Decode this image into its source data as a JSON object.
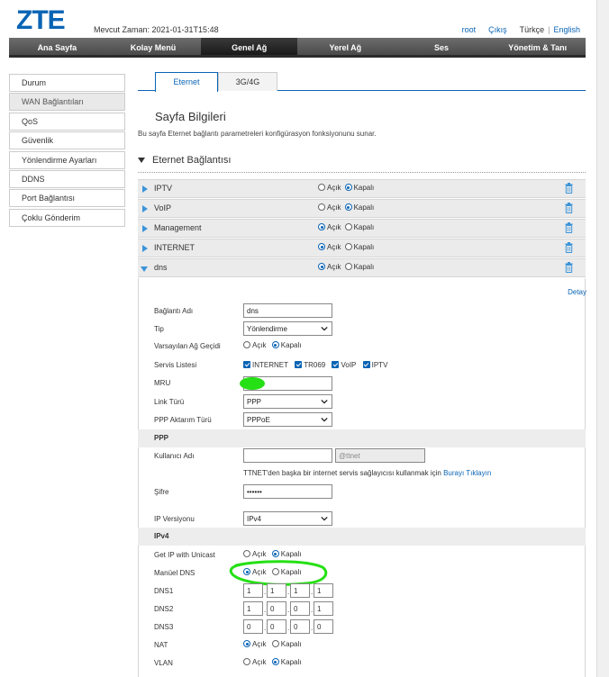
{
  "header": {
    "logo": "ZTE",
    "time_label": "Mevcut Zaman: 2021-01-31T15:48",
    "user": "root",
    "logout": "Çıkış",
    "lang_tr": "Türkçe",
    "lang_sep": "|",
    "lang_en": "English"
  },
  "nav": [
    "Ana Sayfa",
    "Kolay Menü",
    "Genel Ağ",
    "Yerel Ağ",
    "Ses",
    "Yönetim & Tanı"
  ],
  "sidebar": [
    "Durum",
    "WAN Bağlantıları",
    "QoS",
    "Güvenlik",
    "Yönlendirme Ayarları",
    "DDNS",
    "Port Bağlantısı",
    "Çoklu Gönderim"
  ],
  "tabs": [
    "Eternet",
    "3G/4G"
  ],
  "page": {
    "title": "Sayfa Bilgileri",
    "desc": "Bu sayfa Eternet bağlantı parametreleri konfigürasyon fonksiyonunu sunar.",
    "section": "Eternet Bağlantısı"
  },
  "on_label": "Açık",
  "off_label": "Kapalı",
  "connections": [
    {
      "name": "IPTV",
      "enabled": false
    },
    {
      "name": "VoIP",
      "enabled": false
    },
    {
      "name": "Management",
      "enabled": true
    },
    {
      "name": "INTERNET",
      "enabled": true
    },
    {
      "name": "dns",
      "enabled": true
    }
  ],
  "detail": {
    "detay": "Detay",
    "conn_name_label": "Bağlantı Adı",
    "conn_name_value": "dns",
    "type_label": "Tip",
    "type_value": "Yönlendirme",
    "gateway_label": "Varsayılan Ağ Geçidi",
    "service_label": "Servis Listesi",
    "services": [
      "INTERNET",
      "TR069",
      "VoIP",
      "IPTV"
    ],
    "mru_label": "MRU",
    "link_label": "Link Türü",
    "link_value": "PPP",
    "ppp_mode_label": "PPP Aktarım Türü",
    "ppp_mode_value": "PPPoE",
    "ppp_head": "PPP",
    "username_label": "Kullanıcı Adı",
    "username_suffix": "@ttnet",
    "info_text": "TTNET'den başka bir internet servis sağlayıcısı kullanmak için",
    "info_link": "Burayı Tıklayın",
    "password_label": "Şifre",
    "password_value": "••••••",
    "ipver_label": "IP Versiyonu",
    "ipver_value": "IPv4",
    "ipv4_head": "IPv4",
    "unicast_label": "Get IP with Unicast",
    "manualdns_label": "Manüel DNS",
    "dns1_label": "DNS1",
    "dns1": [
      "1",
      "1",
      "1",
      "1"
    ],
    "dns2_label": "DNS2",
    "dns2": [
      "1",
      "0",
      "0",
      "1"
    ],
    "dns3_label": "DNS3",
    "dns3": [
      "0",
      "0",
      "0",
      "0"
    ],
    "nat_label": "NAT",
    "vlan_label": "VLAN"
  },
  "colors": {
    "accent": "#0a64b4",
    "marker": "#25e014"
  }
}
